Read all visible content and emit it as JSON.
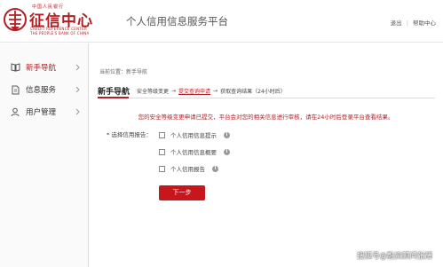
{
  "header": {
    "logo": {
      "top_text": "中国人民银行",
      "main_text": "征信中心",
      "en_line1": "CREDIT REFERENCE CENTER",
      "en_line2": "THE PEOPLE'S BANK OF CHINA"
    },
    "platform_title": "个人信用信息服务平台",
    "logout_label": "退出",
    "help_label": "帮助中心",
    "separator": "|"
  },
  "sidebar": {
    "items": [
      {
        "label": "新手导航",
        "icon": "book-icon",
        "active": true
      },
      {
        "label": "信息服务",
        "icon": "document-icon",
        "active": false
      },
      {
        "label": "用户管理",
        "icon": "user-icon",
        "active": false
      }
    ]
  },
  "main": {
    "breadcrumb": "当前位置：新手导航",
    "section_title": "新手导航",
    "steps": [
      {
        "label": "安全等级变更",
        "current": false
      },
      {
        "label": "提交查询申请",
        "current": true
      },
      {
        "label": "获取查询结果（24小时后）",
        "current": false
      }
    ],
    "step_arrow": "→",
    "notice": "您的安全等级变更申请已提交，平台会对您的相关信息进行审核，请在24小时后登录平台查看结果。",
    "report_label_required": "*",
    "report_label": "选择信用报告：",
    "options": [
      {
        "label": "个人信用信息提示",
        "checked": false
      },
      {
        "label": "个人信用信息概要",
        "checked": false
      },
      {
        "label": "个人信用报告",
        "checked": false
      }
    ],
    "info_glyph": "i",
    "next_button": "下一步"
  },
  "watermark": "搜狐号@融资顾问张耀",
  "colors": {
    "brand_red": "#b11f24",
    "button_red": "#c8161d"
  }
}
